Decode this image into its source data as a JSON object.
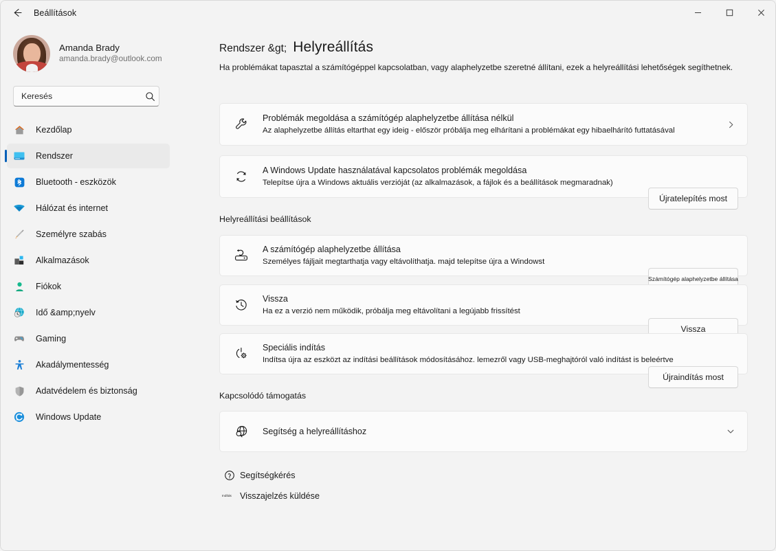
{
  "window": {
    "title": "Beállítások",
    "back_icon": "back-arrow-icon",
    "minimize": "─",
    "maximize": "☐",
    "close": "✕"
  },
  "sidebar": {
    "profile": {
      "name": "Amanda Brady",
      "email": "amanda.brady@outlook.com"
    },
    "search": {
      "placeholder": "Keresés",
      "value": "",
      "icon": "search-icon"
    },
    "items": [
      {
        "label": "Kezdőlap",
        "icon": "home-icon",
        "active": false
      },
      {
        "label": "Rendszer",
        "icon": "system-monitor-icon",
        "active": true
      },
      {
        "label": "Bluetooth - eszközök",
        "icon": "bluetooth-icon",
        "active": false
      },
      {
        "label": "Hálózat és internet",
        "icon": "wifi-icon",
        "active": false
      },
      {
        "label": "Személyre szabás",
        "icon": "paintbrush-icon",
        "active": false
      },
      {
        "label": "Alkalmazások",
        "icon": "apps-icon",
        "active": false
      },
      {
        "label": "Fiókok",
        "icon": "account-person-icon",
        "active": false
      },
      {
        "label": "Idő &amp;nyelv",
        "icon": "clock-globe-icon",
        "active": false
      },
      {
        "label": "Gaming",
        "icon": "gamepad-icon",
        "active": false
      },
      {
        "label": "Akadálymentesség",
        "icon": "accessibility-person-icon",
        "active": false
      },
      {
        "label": "Adatvédelem és biztonság",
        "icon": "shield-icon",
        "active": false
      },
      {
        "label": "Windows Update",
        "icon": "update-refresh-icon",
        "active": false
      }
    ]
  },
  "main": {
    "breadcrumb": "Rendszer &gt;",
    "page_title": "Helyreállítás",
    "page_description": "Ha problémákat tapasztal a számítógéppel kapcsolatban, vagy alaphelyzetbe szeretné állítani, ezek a helyreállítási lehetőségek segíthetnek.",
    "cards": [
      {
        "id": "fix-problems-without-reset",
        "icon": "wrench-icon",
        "title": "Problémák megoldása a számítógép alaphelyzetbe állítása nélkül",
        "description": "Az alaphelyzetbe állítás eltarthat egy ideig - először próbálja meg elhárítani a problémákat egy hibaelhárító futtatásával",
        "trailing": "chevron-right-icon",
        "button": null
      },
      {
        "id": "fix-windows-update-problems",
        "icon": "refresh-circular-icon",
        "title": "A Windows Update használatával kapcsolatos problémák megoldása",
        "description": "Telepítse újra a Windows aktuális verzióját (az alkalmazások, a fájlok és a beállítások megmaradnak)",
        "trailing": null,
        "button": "Újratelepítés most"
      }
    ],
    "sections": [
      {
        "id": "recovery-options",
        "heading": "Helyreállítási beállítások",
        "cards": [
          {
            "id": "reset-pc",
            "icon": "reset-pc-icon",
            "title": "A számítógép alaphelyzetbe állítása",
            "description": "Személyes fájljait megtarthatja vagy eltávolíthatja. majd telepítse újra a Windowst",
            "button": "Számítógép alaphelyzetbe állítása"
          },
          {
            "id": "go-back",
            "icon": "history-clock-icon",
            "title": "Vissza",
            "description": "Ha ez a verzió nem működik, próbálja meg eltávolítani a legújabb frissítést",
            "button": "Vissza"
          },
          {
            "id": "advanced-startup",
            "icon": "power-gear-icon",
            "title": "Speciális indítás",
            "description": "Indítsa újra az eszközt az indítási beállítások módosításához. lemezről vagy USB-meghajtóról való indítást is beleértve",
            "button": "Újraindítás most"
          }
        ]
      },
      {
        "id": "related-support",
        "heading": "Kapcsolódó támogatás",
        "cards": [
          {
            "id": "recovery-help",
            "icon": "globe-search-icon",
            "title": "Segítség a helyreállításhoz",
            "description": null,
            "trailing": "chevron-down-icon",
            "button": null
          }
        ]
      }
    ],
    "footer_links": [
      {
        "id": "get-help",
        "icon": "question-circle-icon",
        "icon_text": null,
        "label": "Segítségkérés"
      },
      {
        "id": "give-feedback",
        "icon": "tiny-text-icon",
        "icon_text": "Indítás",
        "label": "Visszajelzés küldése"
      }
    ]
  },
  "colors": {
    "accent": "#005fb8",
    "window_bg": "#f3f3f3",
    "card_bg": "#fbfbfb",
    "card_border": "#e7e7e7",
    "text": "#1a1a1a",
    "muted_text": "#707070"
  }
}
